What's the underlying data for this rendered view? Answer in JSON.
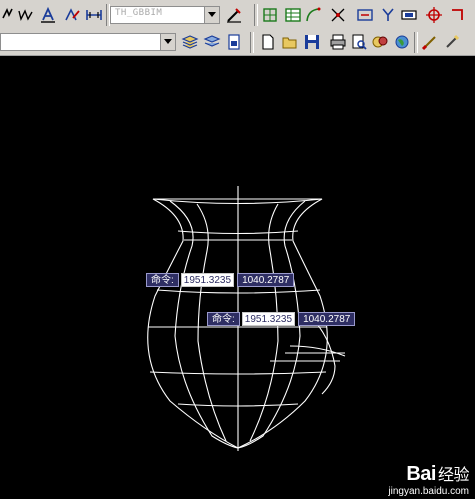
{
  "toolbar": {
    "layer_combo_value": "TH_GBBIM",
    "icons_row1": [
      "lightning-icon",
      "wave-icon",
      "text-style-icon",
      "arc-text-icon",
      "dimension-icon",
      "pen-slash-icon",
      "grid-bracket-icon",
      "table-icon",
      "curve-icon",
      "scatter-icon",
      "tag-icon",
      "fork-icon",
      "box-icon",
      "target-icon",
      "hook-icon"
    ],
    "icons_row2": [
      "layers-icon",
      "stack-icon",
      "document-icon",
      "open-folder-icon",
      "save-icon",
      "print-icon",
      "preview-icon",
      "render-icon",
      "globe-icon",
      "brush-icon",
      "paint-icon"
    ]
  },
  "prompt_1": {
    "label": "命令:",
    "x_value": "1951.3235",
    "y_value": "1040.2787"
  },
  "prompt_2": {
    "label": "命令:",
    "x_value": "1951.3235",
    "y_value": "1040.2787"
  },
  "watermark": {
    "logo": "Bai",
    "logo_cn": "经验",
    "url": "jingyan.baidu.com"
  },
  "colors": {
    "canvas": "#000000",
    "wireframe": "#ffffff",
    "toolbar": "#d6d3ce",
    "tooltip": "#2e2e63"
  }
}
